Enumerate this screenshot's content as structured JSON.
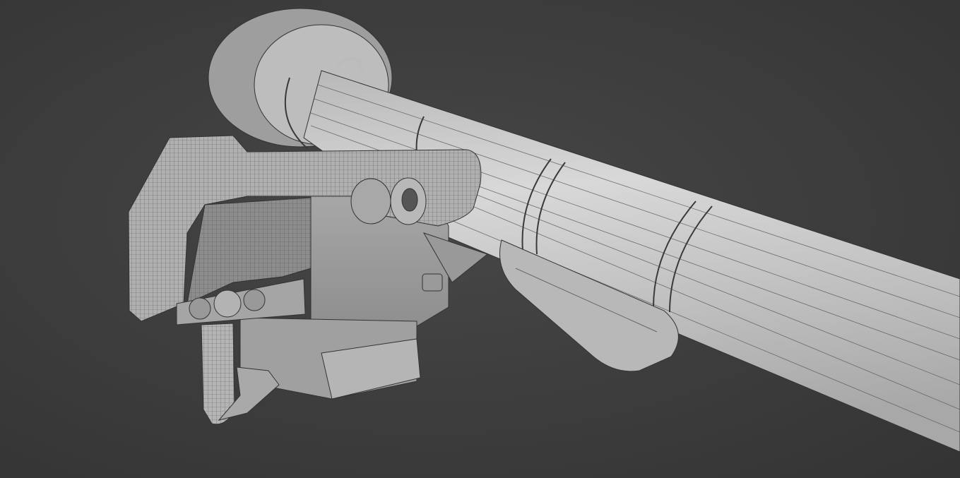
{
  "scene": {
    "background_color": "#3b3b3b",
    "model_color": "#c9c9c9",
    "shadow_color": "#8a8a8a",
    "wire_color": "#3f3f3f"
  }
}
